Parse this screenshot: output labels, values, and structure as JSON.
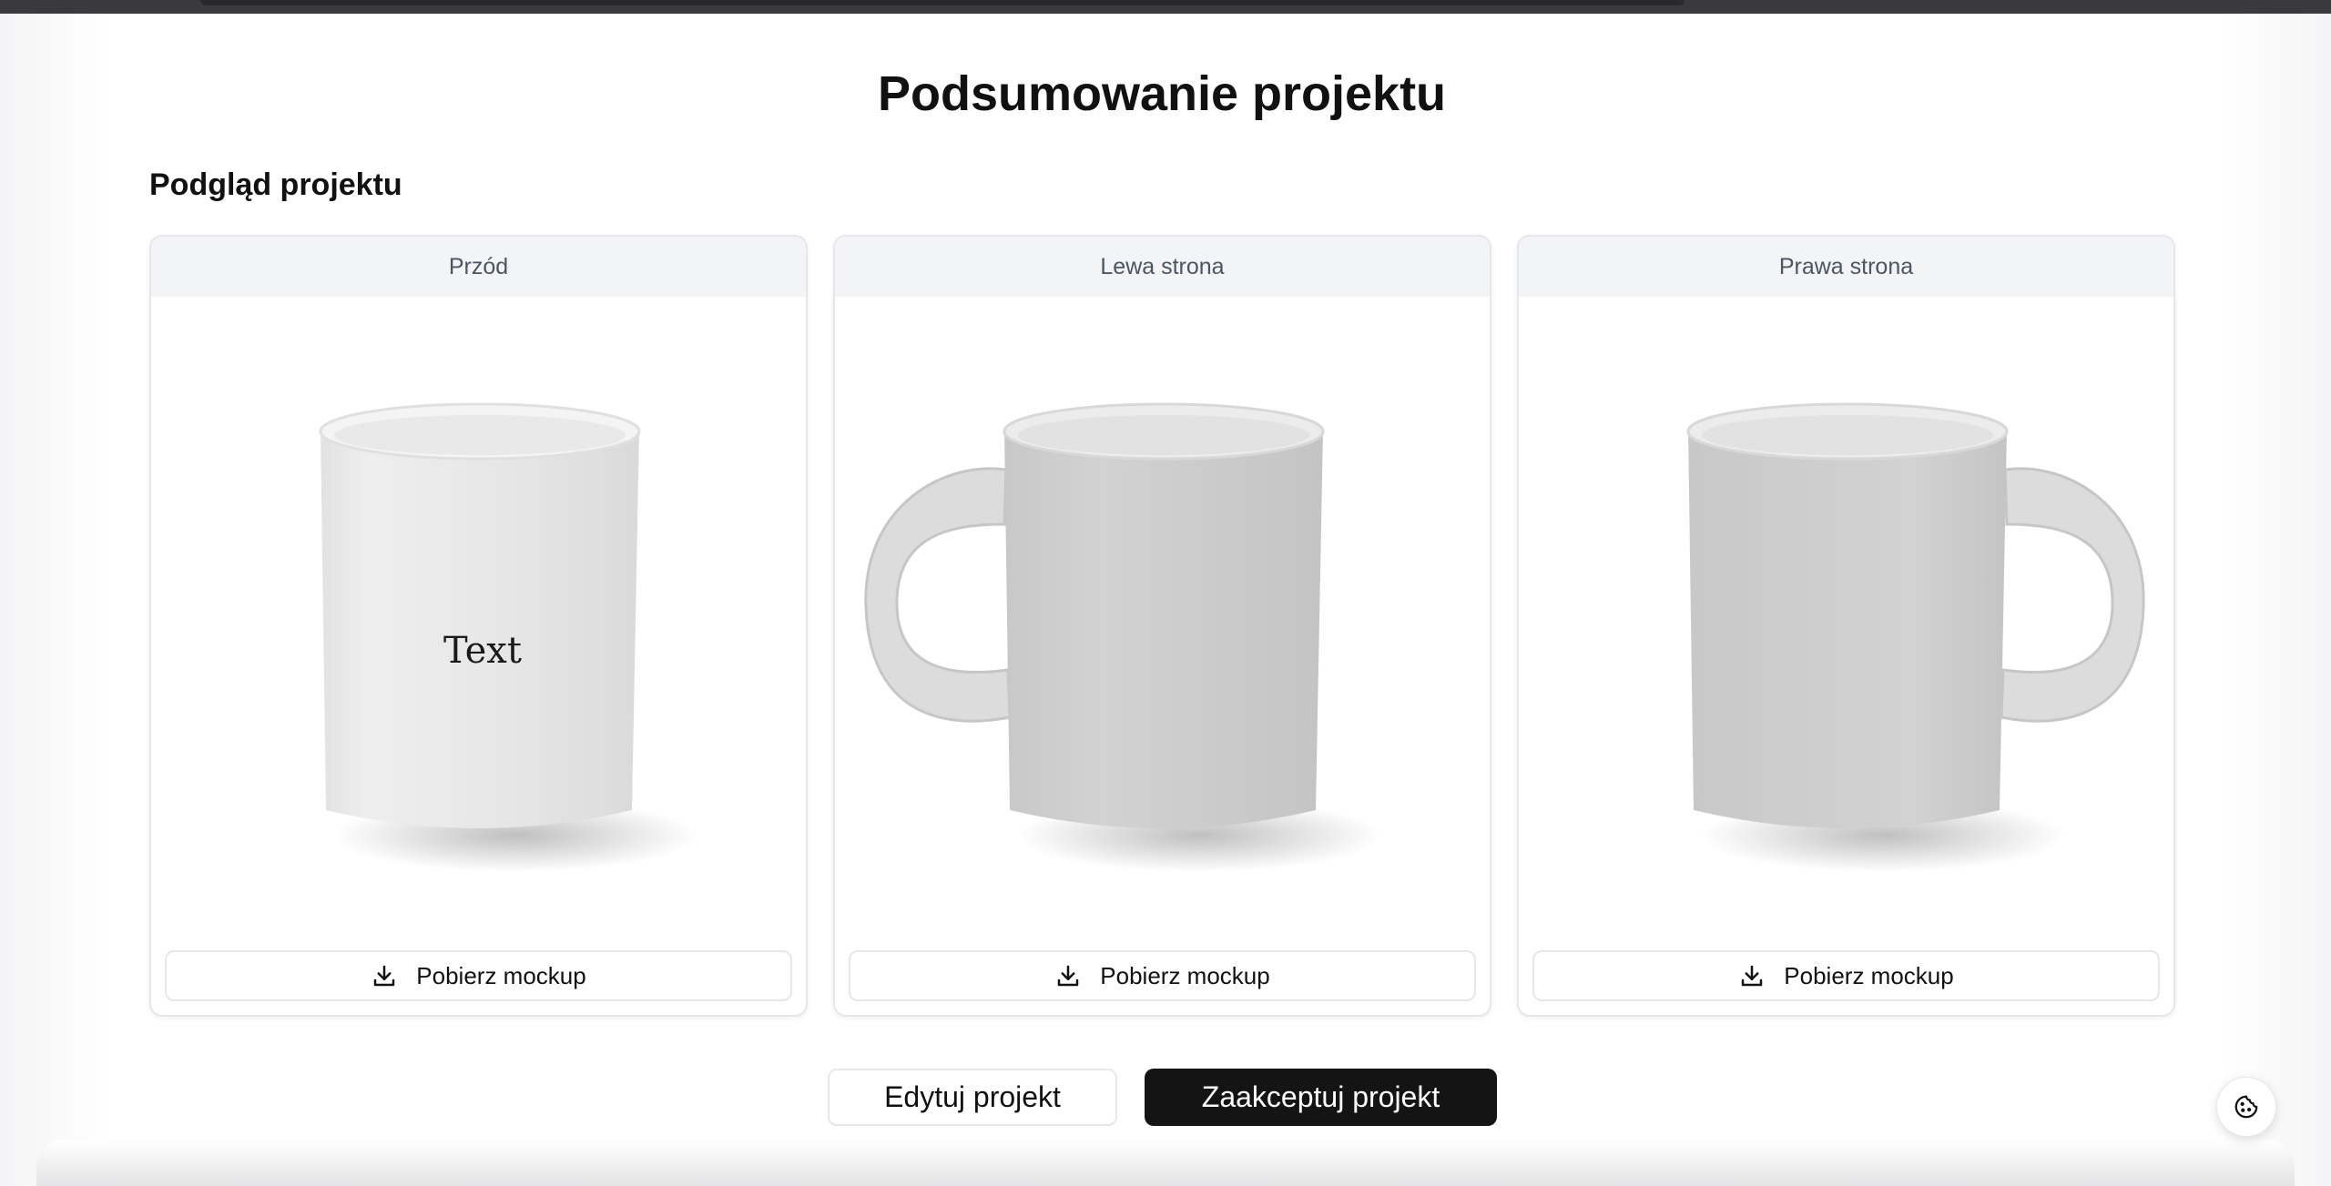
{
  "page": {
    "title": "Podsumowanie projektu",
    "section_title": "Podgląd projektu"
  },
  "previews": [
    {
      "label": "Przód",
      "mug_text": "Text",
      "handle": "none",
      "download_label": "Pobierz mockup"
    },
    {
      "label": "Lewa strona",
      "mug_text": "",
      "handle": "left",
      "download_label": "Pobierz mockup"
    },
    {
      "label": "Prawa strona",
      "mug_text": "",
      "handle": "right",
      "download_label": "Pobierz mockup"
    }
  ],
  "actions": {
    "edit_label": "Edytuj projekt",
    "accept_label": "Zaakceptuj projekt"
  },
  "icons": {
    "download": "download-icon",
    "cookie": "cookie-icon"
  },
  "colors": {
    "primary_button": "#141414",
    "card_header_bg": "#f3f4f6",
    "border": "#e5e7eb"
  }
}
